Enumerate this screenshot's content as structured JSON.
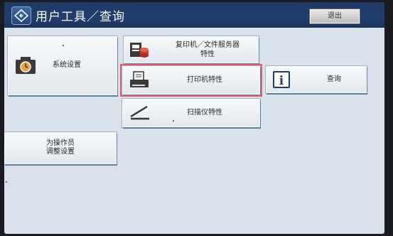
{
  "header": {
    "title": "用户工具／查询",
    "logout_label": "退出"
  },
  "buttons": {
    "system_settings": "系统设置",
    "copier_line1": "复印机／文件服务器",
    "copier_line2": "特性",
    "printer": "打印机特性",
    "query": "查询",
    "scanner": "扫描仪特性",
    "operator_line1": "为操作员",
    "operator_line2": "调整设置"
  },
  "colors": {
    "titlebar": "#1d3a66",
    "screen_bg": "#d9e2ea",
    "selected_outline": "#e45b6a"
  },
  "icons": [
    "home-icon",
    "system-settings-icon",
    "copier-fileserver-icon",
    "printer-icon",
    "info-icon",
    "scanner-icon"
  ]
}
